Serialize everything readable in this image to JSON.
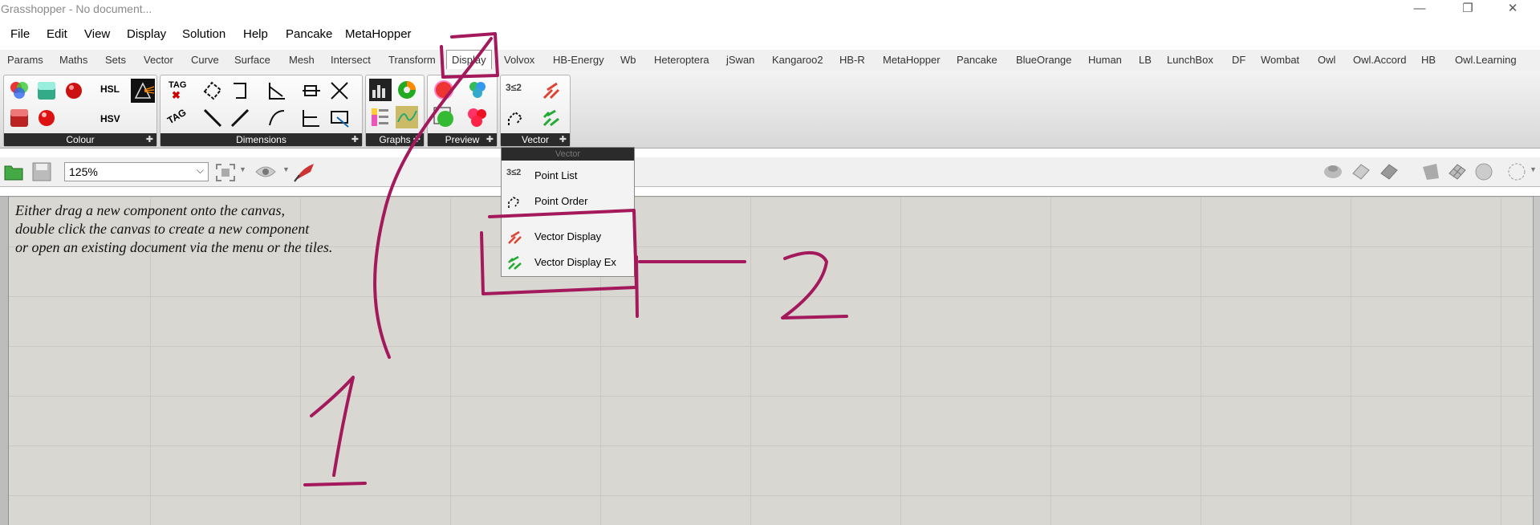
{
  "window": {
    "title": "Grasshopper - No document...",
    "minimize": "—",
    "restore": "❐",
    "close": "✕"
  },
  "menubar": [
    "File",
    "Edit",
    "View",
    "Display",
    "Solution",
    "Help",
    "Pancake",
    "MetaHopper"
  ],
  "tabs": [
    "Params",
    "Maths",
    "Sets",
    "Vector",
    "Curve",
    "Surface",
    "Mesh",
    "Intersect",
    "Transform",
    "Display",
    "Volvox",
    "HB-Energy",
    "Wb",
    "Heteroptera",
    "jSwan",
    "Kangaroo2",
    "HB-R",
    "MetaHopper",
    "Pancake",
    "BlueOrange",
    "Human",
    "LB",
    "LunchBox",
    "DF",
    "Wombat",
    "Owl",
    "Owl.Accord",
    "HB",
    "Owl.Learning"
  ],
  "active_tab": "Display",
  "panels": {
    "colour": "Colour",
    "dimensions": "Dimensions",
    "graphs": "Graphs",
    "preview": "Preview",
    "vector": "Vector",
    "hsl_label": "HSL",
    "hsv_label": "HSV",
    "tag_label": "TAG",
    "vector_icon_text": "3≤2"
  },
  "toolbar": {
    "zoom_value": "125%"
  },
  "canvas_hint": [
    "Either drag a new component onto the canvas,",
    "double click the canvas to create a new component",
    "or open an existing document via the menu or the tiles."
  ],
  "dropdown": {
    "header": "Vector",
    "items": [
      "Point List",
      "Point Order",
      "Vector Display",
      "Vector Display Ex"
    ]
  },
  "annotations": {
    "label_1": "1",
    "label_2": "2",
    "color": "#a3195b"
  },
  "colors": {
    "panel_label_bg": "#2b2b2b",
    "canvas": "#d8d7d2",
    "annotation": "#a3195b"
  }
}
